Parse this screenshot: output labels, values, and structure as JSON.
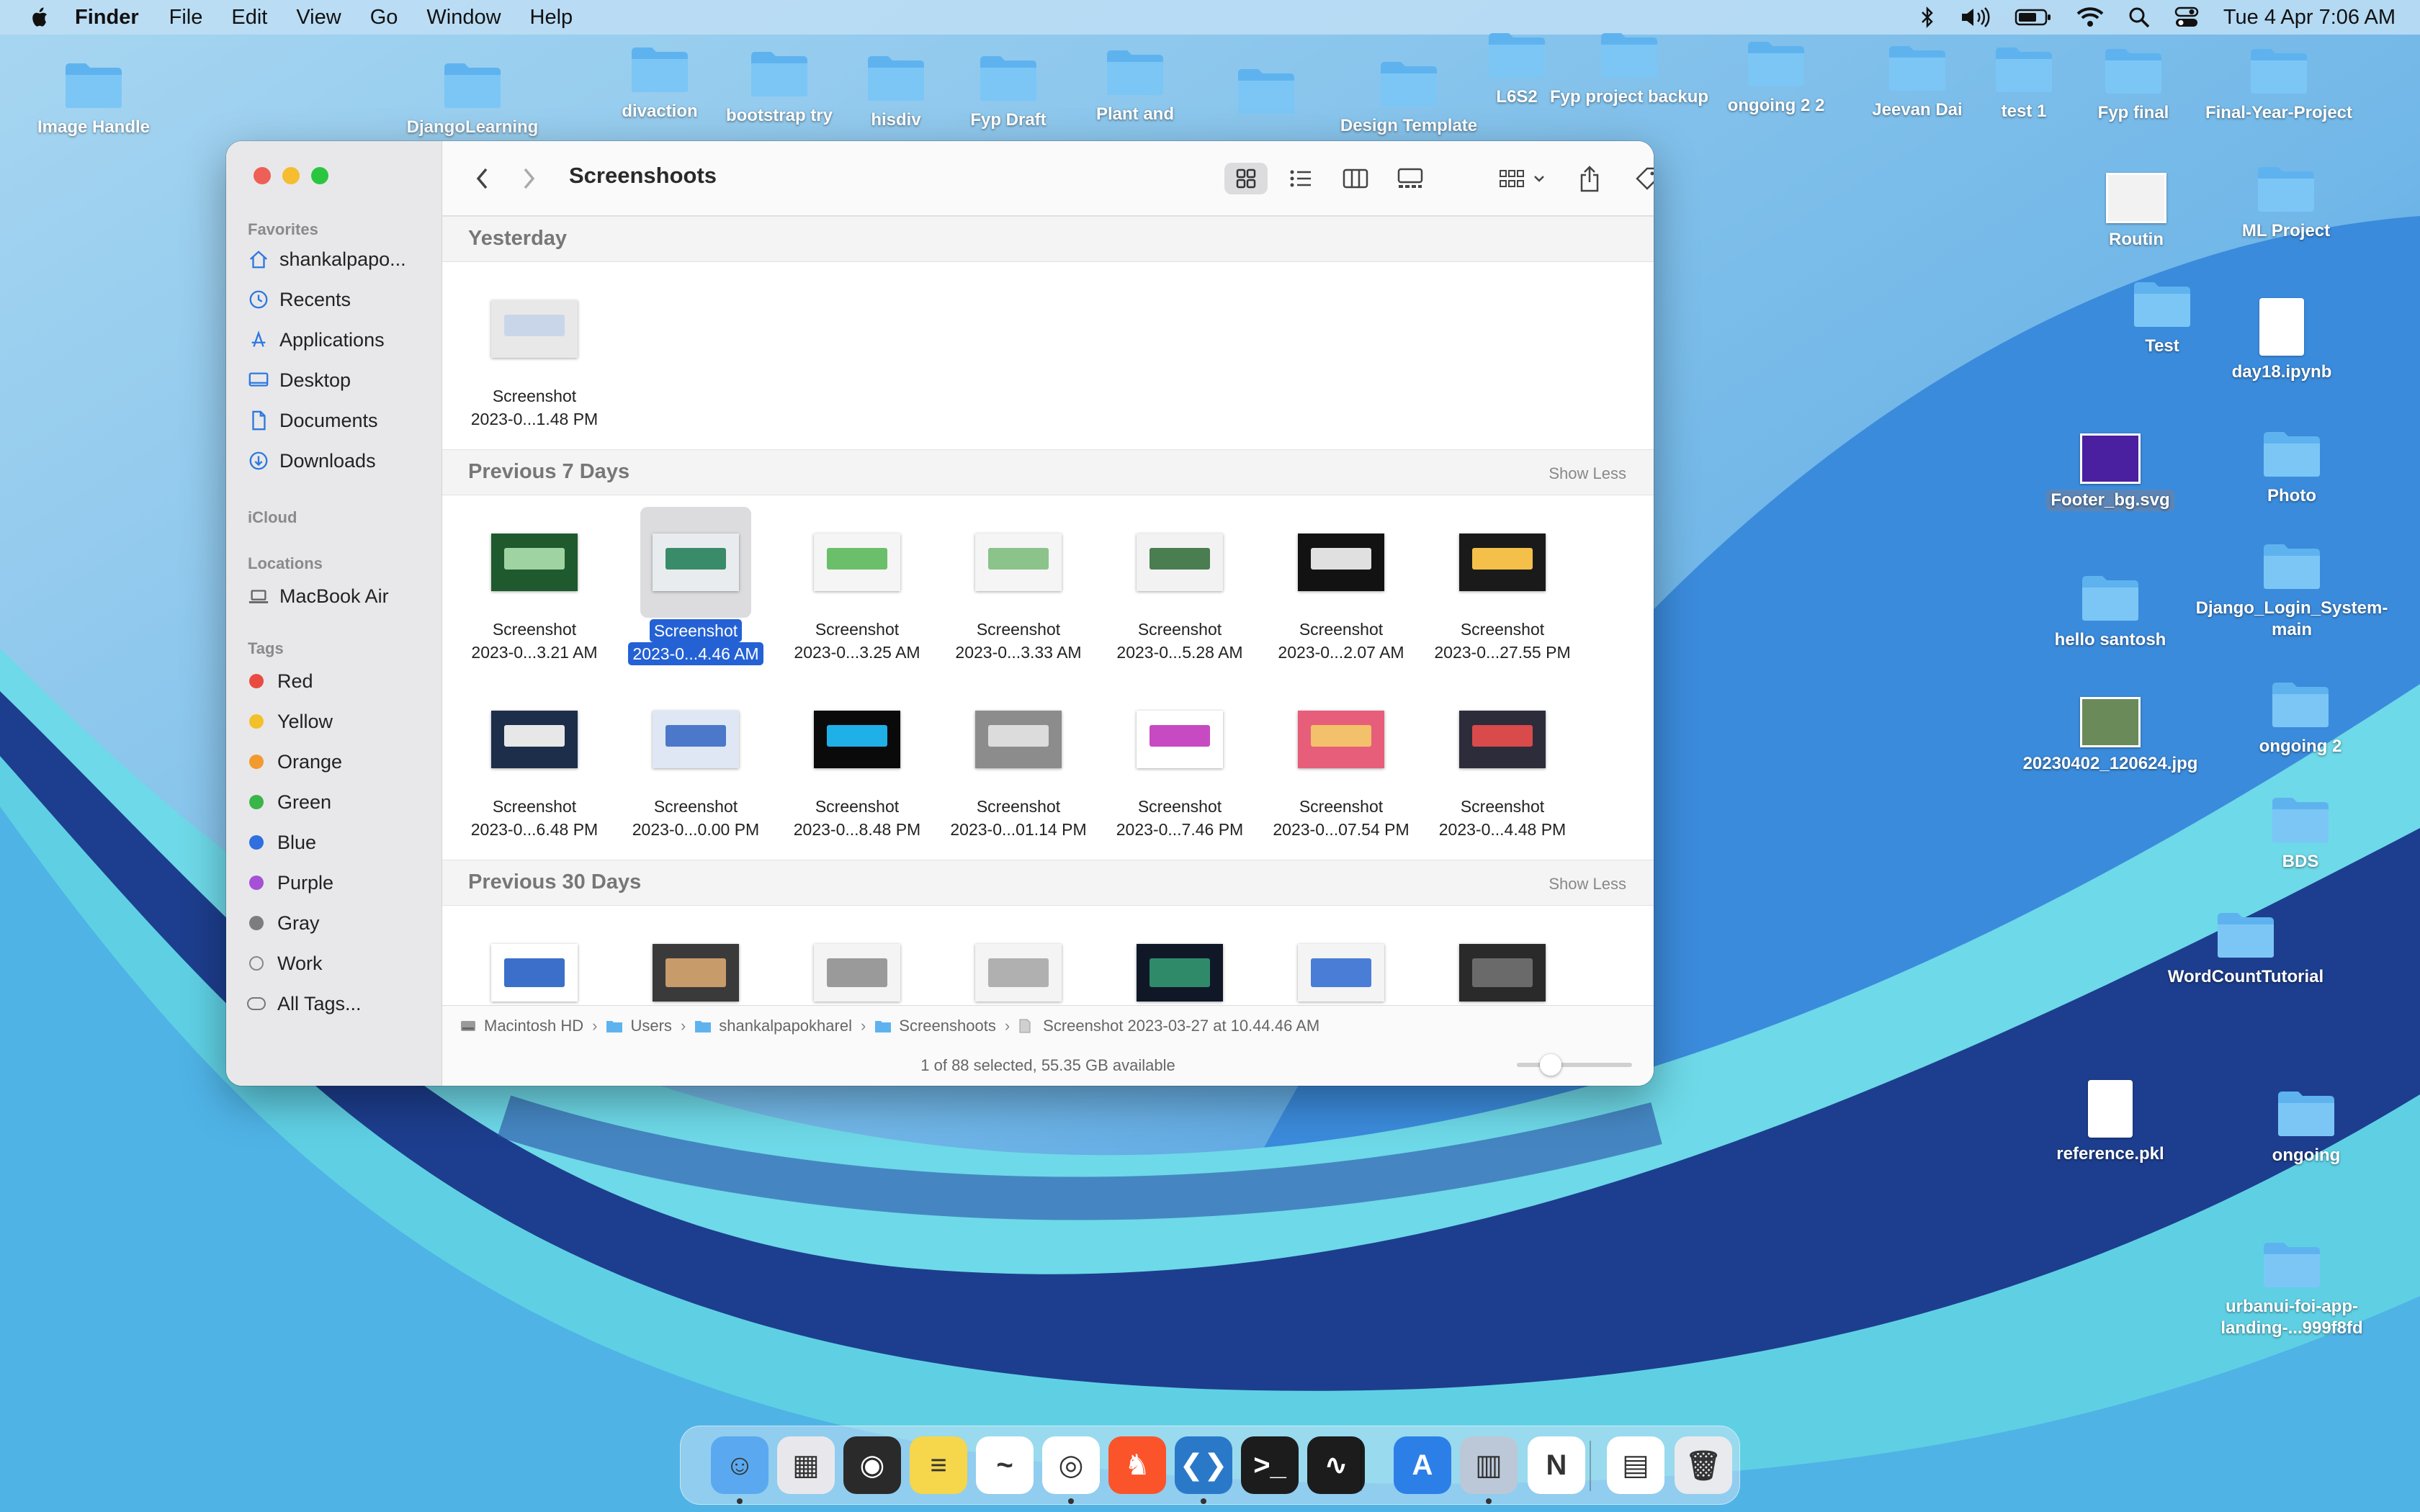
{
  "menubar": {
    "app_name": "Finder",
    "menus": [
      "File",
      "Edit",
      "View",
      "Go",
      "Window",
      "Help"
    ],
    "clock": "Tue 4 Apr  7:06 AM",
    "status_icons": [
      "bluetooth-icon",
      "volume-icon",
      "battery-icon",
      "wifi-icon",
      "search-icon",
      "control-center-icon"
    ]
  },
  "desktop": {
    "icons": [
      {
        "label": "Image Handle",
        "kind": "folder"
      },
      {
        "label": "DjangoLearning",
        "kind": "folder"
      },
      {
        "label": "divaction",
        "kind": "folder"
      },
      {
        "label": "bootstrap try",
        "kind": "folder"
      },
      {
        "label": "hisdiv",
        "kind": "folder"
      },
      {
        "label": "Fyp Draft",
        "kind": "folder"
      },
      {
        "label": "Plant and",
        "kind": "folder"
      },
      {
        "label": "",
        "kind": "folder"
      },
      {
        "label": "Design Template",
        "kind": "folder"
      },
      {
        "label": "L6S2",
        "kind": "folder"
      },
      {
        "label": "Fyp project backup",
        "kind": "folder"
      },
      {
        "label": "ongoing 2 2",
        "kind": "folder"
      },
      {
        "label": "Jeevan Dai",
        "kind": "folder"
      },
      {
        "label": "test 1",
        "kind": "folder"
      },
      {
        "label": "Fyp final",
        "kind": "folder"
      },
      {
        "label": "Final-Year-Project",
        "kind": "folder"
      },
      {
        "label": "Routin",
        "kind": "image"
      },
      {
        "label": "ML Project",
        "kind": "folder"
      },
      {
        "label": "Test",
        "kind": "folder"
      },
      {
        "label": "day18.ipynb",
        "kind": "file"
      },
      {
        "label": "Footer_bg.svg",
        "kind": "image"
      },
      {
        "label": "Photo",
        "kind": "folder"
      },
      {
        "label": "hello santosh",
        "kind": "folder"
      },
      {
        "label": "Django_Login_System-main",
        "kind": "folder"
      },
      {
        "label": "20230402_120624.jpg",
        "kind": "image"
      },
      {
        "label": "ongoing 2",
        "kind": "folder"
      },
      {
        "label": "BDS",
        "kind": "folder"
      },
      {
        "label": "WordCountTutorial",
        "kind": "folder"
      },
      {
        "label": "reference.pkl",
        "kind": "file"
      },
      {
        "label": "ongoing",
        "kind": "folder"
      },
      {
        "label": "urbanui-foi-app-landing-...999f8fd",
        "kind": "folder"
      }
    ]
  },
  "finder": {
    "title": "Screenshoots",
    "sidebar": {
      "favorites_header": "Favorites",
      "favorites": [
        {
          "label": "shankalpapo...",
          "icon": "home-icon"
        },
        {
          "label": "Recents",
          "icon": "clock-icon"
        },
        {
          "label": "Applications",
          "icon": "applications-icon"
        },
        {
          "label": "Desktop",
          "icon": "desktop-icon"
        },
        {
          "label": "Documents",
          "icon": "document-icon"
        },
        {
          "label": "Downloads",
          "icon": "download-icon"
        }
      ],
      "icloud_header": "iCloud",
      "locations_header": "Locations",
      "locations": [
        {
          "label": "MacBook Air",
          "icon": "laptop-icon"
        }
      ],
      "tags_header": "Tags",
      "tags": [
        {
          "label": "Red",
          "color": "#ea4b41"
        },
        {
          "label": "Yellow",
          "color": "#f2c029"
        },
        {
          "label": "Orange",
          "color": "#f29a2e"
        },
        {
          "label": "Green",
          "color": "#39b54a"
        },
        {
          "label": "Blue",
          "color": "#2f6fe0"
        },
        {
          "label": "Purple",
          "color": "#a451d6"
        },
        {
          "label": "Gray",
          "color": "#7d7d80"
        },
        {
          "label": "Work",
          "color": "none"
        },
        {
          "label": "All Tags...",
          "color": "all"
        }
      ]
    },
    "sections": [
      {
        "title": "Yesterday",
        "action": "",
        "files": [
          {
            "line1": "Screenshot",
            "line2": "2023-0...1.48 PM",
            "selected": false
          }
        ]
      },
      {
        "title": "Previous 7 Days",
        "action": "Show Less",
        "files": [
          {
            "line1": "Screenshot",
            "line2": "2023-0...3.21 AM",
            "selected": false
          },
          {
            "line1": "Screenshot",
            "line2": "2023-0...4.46 AM",
            "selected": true
          },
          {
            "line1": "Screenshot",
            "line2": "2023-0...3.25 AM",
            "selected": false
          },
          {
            "line1": "Screenshot",
            "line2": "2023-0...3.33 AM",
            "selected": false
          },
          {
            "line1": "Screenshot",
            "line2": "2023-0...5.28 AM",
            "selected": false
          },
          {
            "line1": "Screenshot",
            "line2": "2023-0...2.07 AM",
            "selected": false
          },
          {
            "line1": "Screenshot",
            "line2": "2023-0...27.55 PM",
            "selected": false
          },
          {
            "line1": "Screenshot",
            "line2": "2023-0...6.48 PM",
            "selected": false
          },
          {
            "line1": "Screenshot",
            "line2": "2023-0...0.00 PM",
            "selected": false
          },
          {
            "line1": "Screenshot",
            "line2": "2023-0...8.48 PM",
            "selected": false
          },
          {
            "line1": "Screenshot",
            "line2": "2023-0...01.14 PM",
            "selected": false
          },
          {
            "line1": "Screenshot",
            "line2": "2023-0...7.46 PM",
            "selected": false
          },
          {
            "line1": "Screenshot",
            "line2": "2023-0...07.54 PM",
            "selected": false
          },
          {
            "line1": "Screenshot",
            "line2": "2023-0...4.48 PM",
            "selected": false
          }
        ]
      },
      {
        "title": "Previous 30 Days",
        "action": "Show Less",
        "files": []
      }
    ],
    "path": [
      {
        "label": "Macintosh HD",
        "icon": "disk-icon"
      },
      {
        "label": "Users",
        "icon": "folder-icon"
      },
      {
        "label": "shankalpapokharel",
        "icon": "folder-icon"
      },
      {
        "label": "Screenshoots",
        "icon": "folder-icon"
      },
      {
        "label": "Screenshot 2023-03-27 at 10.44.46 AM",
        "icon": "file-icon"
      }
    ],
    "status": "1 of 88 selected, 55.35 GB available",
    "icon_size_slider": 0.2
  },
  "dock": {
    "apps": [
      "finder-icon",
      "launchpad-icon",
      "screenshot-icon",
      "notes-icon",
      "freeform-icon",
      "chrome-icon",
      "brave-icon",
      "vscode-icon",
      "terminal-icon",
      "activity-monitor-icon",
      "app-store-icon",
      "parallels-icon",
      "notion-icon",
      "document-preview-icon",
      "trash-icon"
    ]
  }
}
